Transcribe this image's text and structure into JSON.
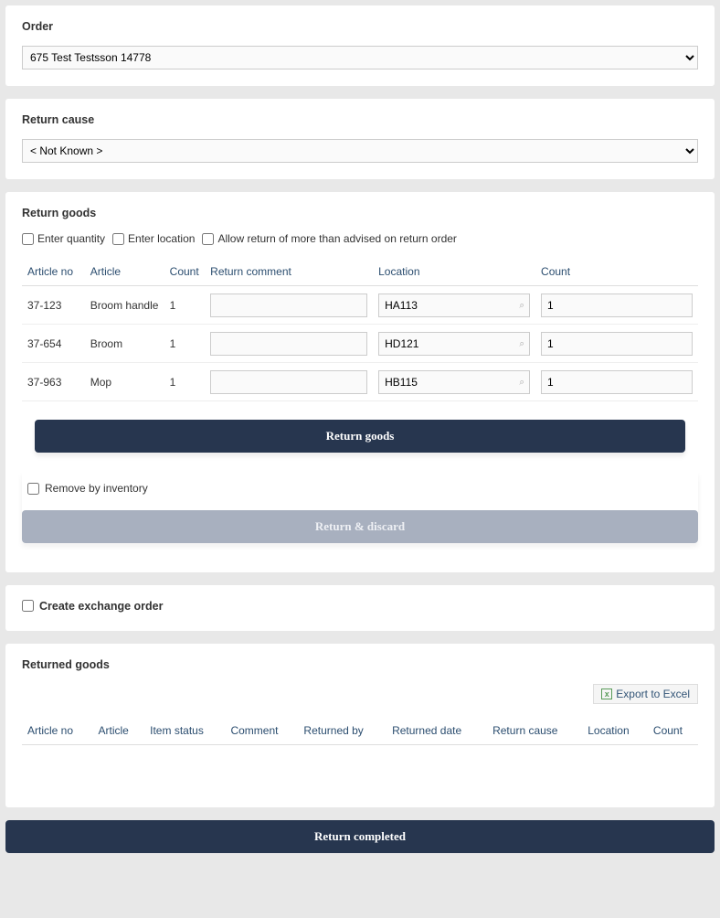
{
  "order": {
    "title": "Order",
    "selected": "675    Test Testsson    14778"
  },
  "return_cause": {
    "title": "Return cause",
    "selected": "< Not Known >"
  },
  "return_goods": {
    "title": "Return goods",
    "checkboxes": {
      "enter_quantity": "Enter quantity",
      "enter_location": "Enter location",
      "allow_more": "Allow return of more than advised on return order"
    },
    "headers": {
      "article_no": "Article no",
      "article": "Article",
      "count": "Count",
      "return_comment": "Return comment",
      "location": "Location",
      "count2": "Count"
    },
    "rows": [
      {
        "article_no": "37-123",
        "article": "Broom handle",
        "count": "1",
        "comment": "",
        "location": "HA113",
        "count2": "1"
      },
      {
        "article_no": "37-654",
        "article": "Broom",
        "count": "1",
        "comment": "",
        "location": "HD121",
        "count2": "1"
      },
      {
        "article_no": "37-963",
        "article": "Mop",
        "count": "1",
        "comment": "",
        "location": "HB115",
        "count2": "1"
      }
    ],
    "return_goods_btn": "Return goods",
    "remove_by_inventory": "Remove by inventory",
    "return_discard_btn": "Return & discard"
  },
  "exchange": {
    "label": "Create exchange order"
  },
  "returned_goods": {
    "title": "Returned goods",
    "export_label": "Export to Excel",
    "headers": {
      "article_no": "Article no",
      "article": "Article",
      "item_status": "Item status",
      "comment": "Comment",
      "returned_by": "Returned by",
      "returned_date": "Returned date",
      "return_cause": "Return cause",
      "location": "Location",
      "count": "Count"
    }
  },
  "return_completed_btn": "Return completed"
}
